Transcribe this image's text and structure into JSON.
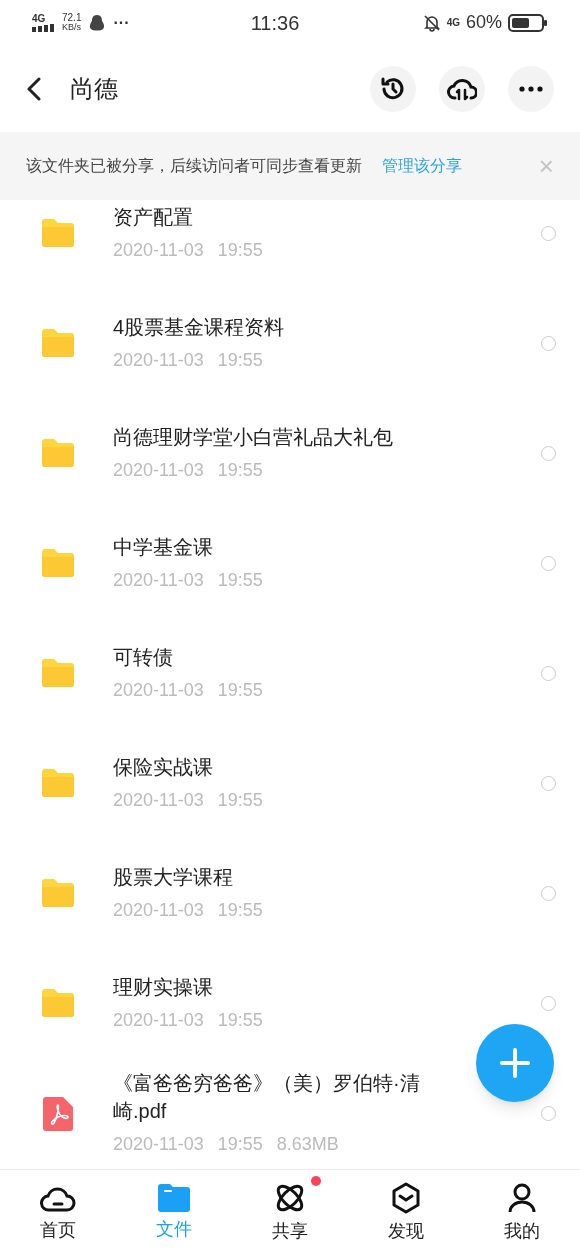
{
  "status_bar": {
    "network": "4G",
    "speed_value": "72.1",
    "speed_unit": "KB/s",
    "more": "···",
    "time": "11:36",
    "network_right": "4G",
    "battery": "60%"
  },
  "header": {
    "title": "尚德"
  },
  "banner": {
    "message": "该文件夹已被分享，后续访问者可同步查看更新",
    "action": "管理该分享",
    "close": "×"
  },
  "files": [
    {
      "kind": "folder",
      "name": "资产配置",
      "date": "2020-11-03",
      "time": "19:55",
      "selected": false
    },
    {
      "kind": "folder",
      "name": "4股票基金课程资料",
      "date": "2020-11-03",
      "time": "19:55",
      "selected": false
    },
    {
      "kind": "folder",
      "name": "尚德理财学堂小白营礼品大礼包",
      "date": "2020-11-03",
      "time": "19:55",
      "selected": false
    },
    {
      "kind": "folder",
      "name": "中学基金课",
      "date": "2020-11-03",
      "time": "19:55",
      "selected": false
    },
    {
      "kind": "folder",
      "name": "可转债",
      "date": "2020-11-03",
      "time": "19:55",
      "selected": false
    },
    {
      "kind": "folder",
      "name": "保险实战课",
      "date": "2020-11-03",
      "time": "19:55",
      "selected": false
    },
    {
      "kind": "folder",
      "name": "股票大学课程",
      "date": "2020-11-03",
      "time": "19:55",
      "selected": false
    },
    {
      "kind": "folder",
      "name": "理财实操课",
      "date": "2020-11-03",
      "time": "19:55",
      "selected": false
    },
    {
      "kind": "pdf",
      "name": "《富爸爸穷爸爸》（美）罗伯特·清崎.pdf",
      "date": "2020-11-03",
      "time": "19:55",
      "size": "8.63MB",
      "selected": false
    }
  ],
  "tabs": [
    {
      "kind": "home",
      "label": "首页",
      "selected": false,
      "badge": false
    },
    {
      "kind": "files",
      "label": "文件",
      "selected": true,
      "badge": false
    },
    {
      "kind": "share",
      "label": "共享",
      "selected": false,
      "badge": true
    },
    {
      "kind": "discover",
      "label": "发现",
      "selected": false,
      "badge": false
    },
    {
      "kind": "me",
      "label": "我的",
      "selected": false,
      "badge": false
    }
  ]
}
